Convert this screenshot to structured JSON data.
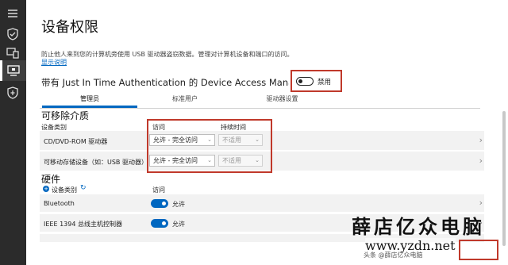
{
  "page": {
    "title": "设备权限",
    "description": "防止他人来到您的计算机旁使用 USB 驱动器盗窃数据。管理对计算机设备和端口的访问。",
    "show_link": "显示说明"
  },
  "jit": {
    "label": "带有 Just In Time Authentication 的 Device Access Manage",
    "toggle_label": "禁用",
    "toggle_on": false
  },
  "tabs": [
    {
      "label": "管理员",
      "selected": true
    },
    {
      "label": "标准用户",
      "selected": false
    },
    {
      "label": "驱动器设置",
      "selected": false
    }
  ],
  "removable": {
    "heading": "可移除介质",
    "col_device": "设备类别",
    "col_access": "访问",
    "col_duration": "持续时间",
    "rows": [
      {
        "label": "CD/DVD-ROM 驱动器",
        "access": "允许 - 完全访问",
        "duration": "不适用"
      },
      {
        "label": "可移动存储设备（如：USB 驱动器）",
        "access": "允许 - 完全访问",
        "duration": "不适用"
      }
    ]
  },
  "hardware": {
    "heading": "硬件",
    "col_device": "设备类别",
    "col_access": "访问",
    "rows": [
      {
        "label": "Bluetooth",
        "state": "允许",
        "on": true
      },
      {
        "label": "IEEE 1394 总线主机控制器",
        "state": "允许",
        "on": true
      }
    ]
  },
  "watermark": {
    "brand": "薛店亿众电脑",
    "url": "www.yzdn.net",
    "caption": "头条 @薛店亿众电脑"
  },
  "colors": {
    "accent": "#0067c0",
    "highlight_box": "#c0392b",
    "sidebar": "#2b2b2b"
  }
}
